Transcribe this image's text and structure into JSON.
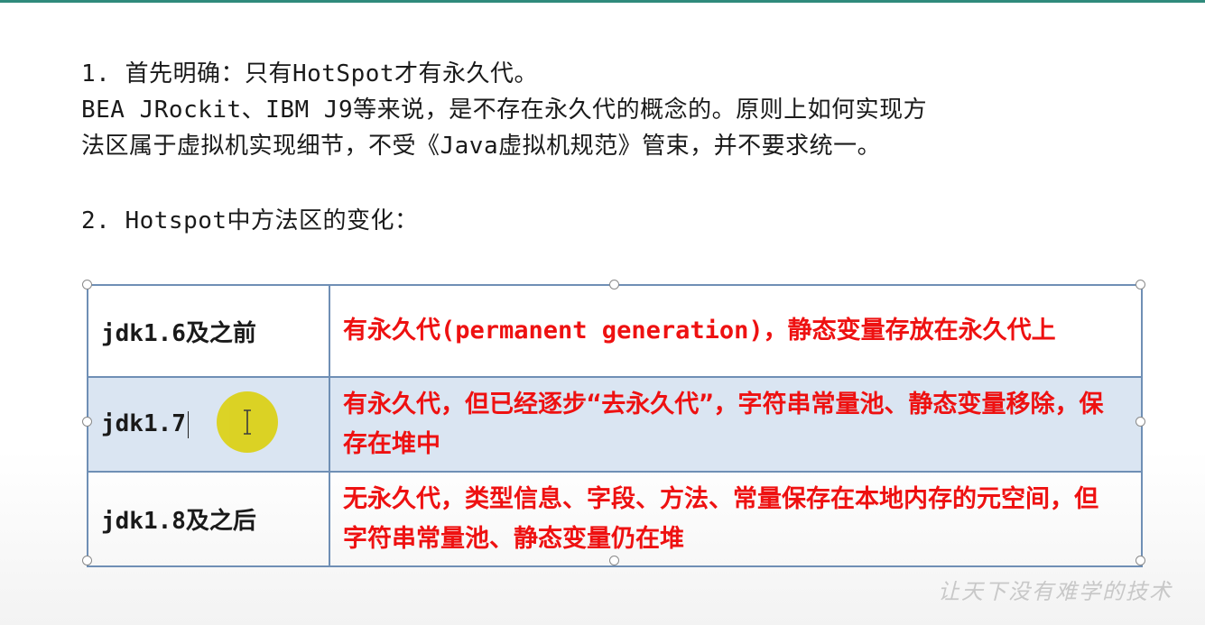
{
  "slide": {
    "paragraphs": [
      "1. 首先明确：只有HotSpot才有永久代。",
      "BEA JRockit、IBM J9等来说，是不存在永久代的概念的。原则上如何实现方",
      "法区属于虚拟机实现细节，不受《Java虚拟机规范》管束，并不要求统一。",
      "2. Hotspot中方法区的变化："
    ],
    "table": {
      "rows": [
        {
          "version": "jdk1.6及之前",
          "description": "有永久代(permanent generation)，静态变量存放在永久代上"
        },
        {
          "version": "jdk1.7",
          "description": "有永久代，但已经逐步“去永久代”，字符串常量池、静态变量移除，保存在堆中"
        },
        {
          "version": "jdk1.8及之后",
          "description": "无永久代，类型信息、字段、方法、常量保存在本地内存的元空间，但字符串常量池、静态变量仍在堆"
        }
      ]
    },
    "watermark": "让天下没有难学的技术"
  },
  "colors": {
    "accent_rule": "#2f8a7c",
    "description_text": "#ee1111",
    "selected_row_fill": "#dae5f2",
    "table_border": "#6f8fb5",
    "cursor_halo": "#dcd21a"
  },
  "icons": {
    "cursor": "text-cursor-icon"
  }
}
